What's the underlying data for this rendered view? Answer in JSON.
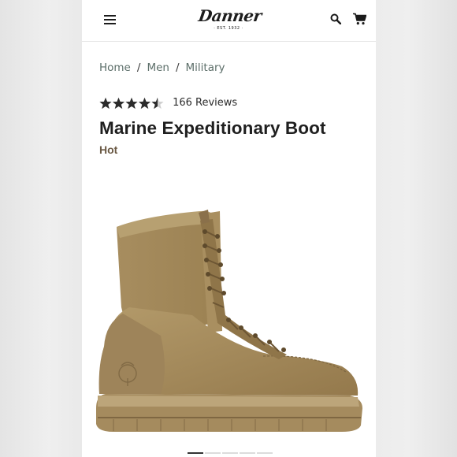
{
  "header": {
    "logo_text": "Danner",
    "logo_subtext": "· EST. 1932 ·",
    "menu_icon": "hamburger-icon",
    "search_icon": "search-icon",
    "cart_icon": "cart-icon"
  },
  "breadcrumb": {
    "items": [
      "Home",
      "Men",
      "Military"
    ],
    "separator": "/"
  },
  "product": {
    "rating": 4.5,
    "rating_max": 5,
    "reviews_label": "166 Reviews",
    "name": "Marine Expeditionary Boot",
    "variant": "Hot",
    "image_subject": "boot-image"
  },
  "carousel": {
    "count": 5,
    "active_index": 0
  },
  "colors": {
    "breadcrumb": "#5d6f6a",
    "variant": "#6b5a45",
    "star": "#2b2b2b",
    "boot": "#a78d5f"
  }
}
